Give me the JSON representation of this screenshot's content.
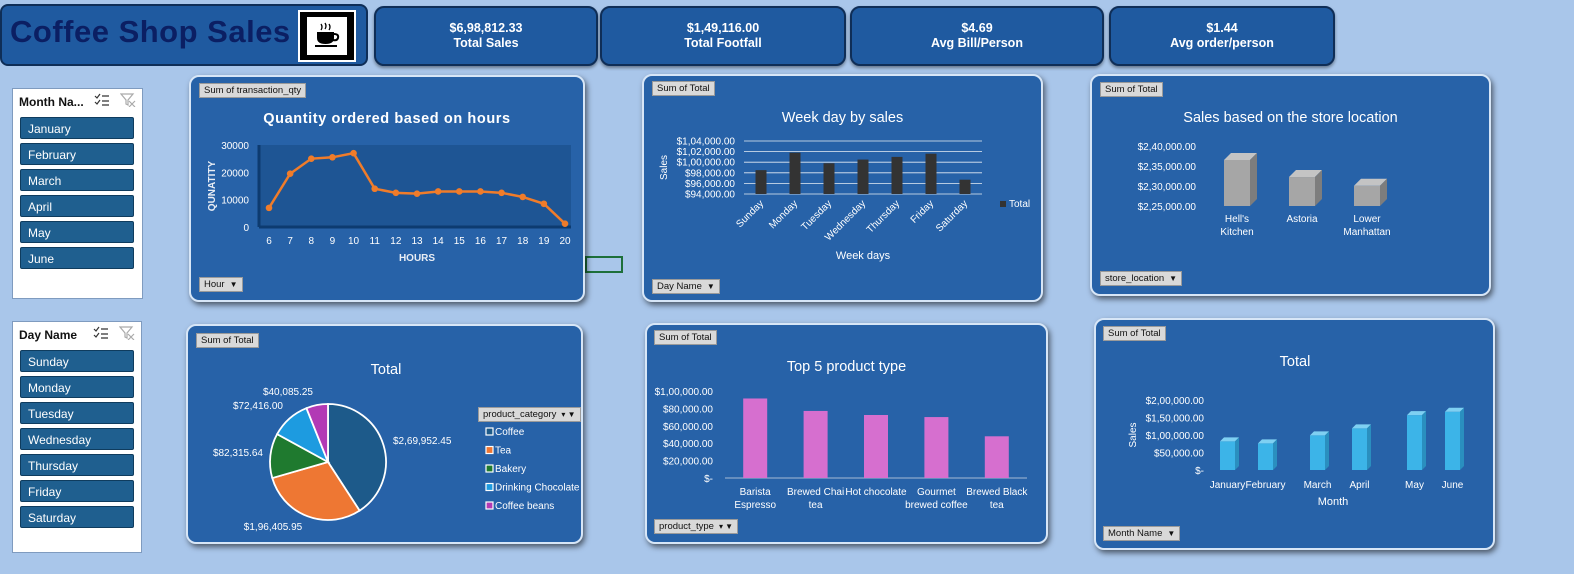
{
  "header": {
    "title": "Coffee Shop Sales",
    "logo_icon": "coffee-cup-icon"
  },
  "kpis": [
    {
      "value": "$6,98,812.33",
      "label": "Total Sales"
    },
    {
      "value": "$1,49,116.00",
      "label": "Total Footfall"
    },
    {
      "value": "$4.69",
      "label": "Avg Bill/Person"
    },
    {
      "value": "$1.44",
      "label": "Avg order/person"
    }
  ],
  "month_slicer": {
    "title": "Month Na...",
    "items": [
      "January",
      "February",
      "March",
      "April",
      "May",
      "June"
    ]
  },
  "day_slicer": {
    "title": "Day Name",
    "items": [
      "Sunday",
      "Monday",
      "Tuesday",
      "Wednesday",
      "Thursday",
      "Friday",
      "Saturday"
    ]
  },
  "hours_chart": {
    "field_button": "Sum of transaction_qty",
    "filter_button": "Hour",
    "chart_data": {
      "type": "line",
      "title": "Quantity ordered based on hours",
      "xlabel": "HOURS",
      "ylabel": "QUNATITY",
      "x": [
        "6",
        "7",
        "8",
        "9",
        "10",
        "11",
        "12",
        "13",
        "14",
        "15",
        "16",
        "17",
        "18",
        "19",
        "20"
      ],
      "values": [
        7000,
        19500,
        25000,
        25500,
        27000,
        14000,
        12500,
        12200,
        13000,
        13000,
        13000,
        12500,
        11000,
        8500,
        1200
      ],
      "ylim": [
        0,
        30000
      ],
      "yticks": [
        "30000",
        "20000",
        "10000",
        "0"
      ],
      "color": "#f07c2a"
    }
  },
  "weekday_chart": {
    "field_button": "Sum of Total",
    "filter_button": "Day Name",
    "chart_data": {
      "type": "bar",
      "title": "Week day by sales",
      "xlabel": "Week days",
      "ylabel": "Sales",
      "categories": [
        "Sunday",
        "Monday",
        "Tuesday",
        "Wednesday",
        "Thursday",
        "Friday",
        "Saturday"
      ],
      "values": [
        98500,
        101800,
        99800,
        100500,
        101000,
        101600,
        96700
      ],
      "ylim": [
        94000,
        104000
      ],
      "yticks": [
        "$1,04,000.00",
        "$1,02,000.00",
        "$1,00,000.00",
        "$98,000.00",
        "$96,000.00",
        "$94,000.00"
      ],
      "legend": "Total",
      "color": "#333333"
    }
  },
  "store_chart": {
    "field_button": "Sum of Total",
    "filter_button": "store_location",
    "chart_data": {
      "type": "bar",
      "title": "Sales based on the store location",
      "categories": [
        "Hell's Kitchen",
        "Astoria",
        "Lower Manhattan"
      ],
      "values": [
        236511,
        232243,
        230057
      ],
      "ylim": [
        225000,
        240000
      ],
      "yticks": [
        "$2,40,000.00",
        "$2,35,000.00",
        "$2,30,000.00",
        "$2,25,000.00"
      ],
      "color": "#a6a6a6"
    }
  },
  "category_chart": {
    "field_button": "Sum of Total",
    "filter_button": "product_category",
    "chart_data": {
      "type": "pie",
      "title": "Total",
      "slices": [
        {
          "label": "Coffee",
          "value": 269952.45,
          "text": "$2,69,952.45",
          "color": "#1d5a8a"
        },
        {
          "label": "Tea",
          "value": 196405.95,
          "text": "$1,96,405.95",
          "color": "#ee7733"
        },
        {
          "label": "Bakery",
          "value": 82315.64,
          "text": "$82,315.64",
          "color": "#1f7a2f"
        },
        {
          "label": "Drinking Chocolate",
          "value": 72416.0,
          "text": "$72,416.00",
          "color": "#1d9be0"
        },
        {
          "label": "Coffee beans",
          "value": 40085.25,
          "text": "$40,085.25",
          "color": "#b23ab5"
        }
      ]
    }
  },
  "product_chart": {
    "field_button": "Sum of Total",
    "filter_button": "product_type",
    "chart_data": {
      "type": "bar",
      "title": "Top 5 product type",
      "categories": [
        "Barista Espresso",
        "Brewed Chai tea",
        "Hot chocolate",
        "Gourmet brewed coffee",
        "Brewed Black tea"
      ],
      "values": [
        91406,
        77082,
        72416,
        70034,
        47933
      ],
      "ylim": [
        0,
        100000
      ],
      "yticks": [
        "$1,00,000.00",
        "$80,000.00",
        "$60,000.00",
        "$40,000.00",
        "$20,000.00",
        "$-"
      ],
      "color": "#d66fcf"
    }
  },
  "month_chart": {
    "field_button": "Sum of Total",
    "filter_button": "Month Name",
    "chart_data": {
      "type": "bar",
      "title": "Total",
      "xlabel": "Month",
      "ylabel": "Sales",
      "categories": [
        "January",
        "February",
        "March",
        "April",
        "May",
        "June"
      ],
      "values": [
        81678,
        76145,
        98835,
        118941,
        156728,
        166486
      ],
      "ylim": [
        0,
        200000
      ],
      "yticks": [
        "$2,00,000.00",
        "$1,50,000.00",
        "$1,00,000.00",
        "$50,000.00",
        "$-"
      ],
      "color": "#3cb4e8"
    }
  }
}
